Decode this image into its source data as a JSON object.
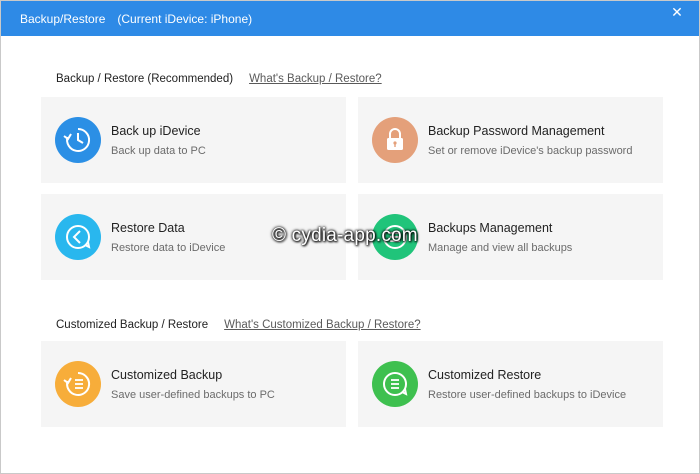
{
  "window": {
    "title": "Backup/Restore",
    "device": "(Current iDevice: iPhone)",
    "close_symbol": "✕"
  },
  "sections": [
    {
      "heading": "Backup / Restore (Recommended)",
      "link": "What's Backup / Restore?"
    },
    {
      "heading": "Customized Backup / Restore",
      "link": "What's Customized Backup / Restore?"
    }
  ],
  "cards": [
    {
      "title": "Back up iDevice",
      "subtitle": "Back up data to PC",
      "icon": "backup-icon",
      "color": "#2b8fe5"
    },
    {
      "title": "Backup Password Management",
      "subtitle": "Set or remove iDevice's backup password",
      "icon": "lock-icon",
      "color": "#e4a07a"
    },
    {
      "title": "Restore Data",
      "subtitle": "Restore data to iDevice",
      "icon": "restore-icon",
      "color": "#29b7ee"
    },
    {
      "title": "Backups Management",
      "subtitle": "Manage and view all backups",
      "icon": "backups-manage-icon",
      "color": "#20c47a"
    },
    {
      "title": "Customized Backup",
      "subtitle": "Save user-defined backups to PC",
      "icon": "custom-backup-icon",
      "color": "#f7ad3a"
    },
    {
      "title": "Customized Restore",
      "subtitle": "Restore user-defined backups to iDevice",
      "icon": "custom-restore-icon",
      "color": "#3ec04f"
    }
  ],
  "watermark": "© cydia-app.com"
}
